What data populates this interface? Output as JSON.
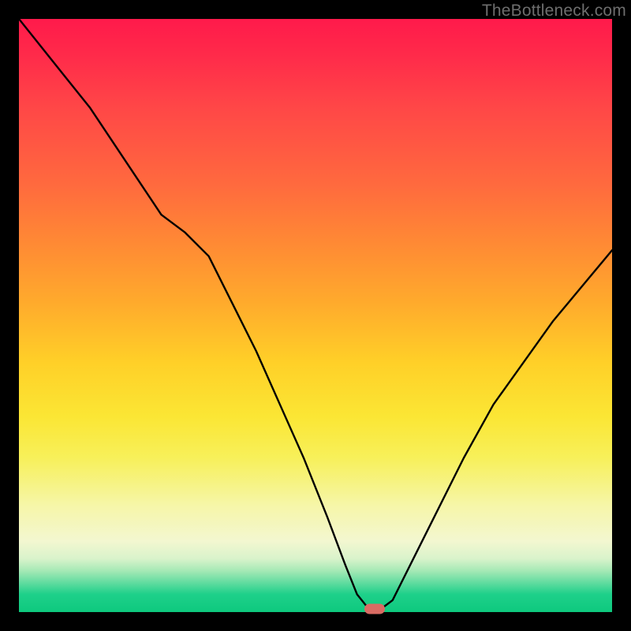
{
  "watermark": "TheBottleneck.com",
  "chart_data": {
    "type": "line",
    "title": "",
    "xlabel": "",
    "ylabel": "",
    "xlim": [
      0,
      100
    ],
    "ylim": [
      0,
      100
    ],
    "grid": false,
    "legend": false,
    "background": "red-yellow-green vertical gradient",
    "marker": {
      "x": 60,
      "y": 0,
      "color": "#d96b63"
    },
    "series": [
      {
        "name": "bottleneck-curve",
        "color": "#000000",
        "x": [
          0,
          4,
          8,
          12,
          16,
          20,
          24,
          28,
          32,
          36,
          40,
          44,
          48,
          52,
          55,
          57,
          59,
          61,
          63,
          66,
          70,
          75,
          80,
          85,
          90,
          95,
          100
        ],
        "y": [
          100,
          95,
          90,
          85,
          79,
          73,
          67,
          64,
          60,
          52,
          44,
          35,
          26,
          16,
          8,
          3,
          0.5,
          0.5,
          2,
          8,
          16,
          26,
          35,
          42,
          49,
          55,
          61
        ]
      }
    ]
  }
}
